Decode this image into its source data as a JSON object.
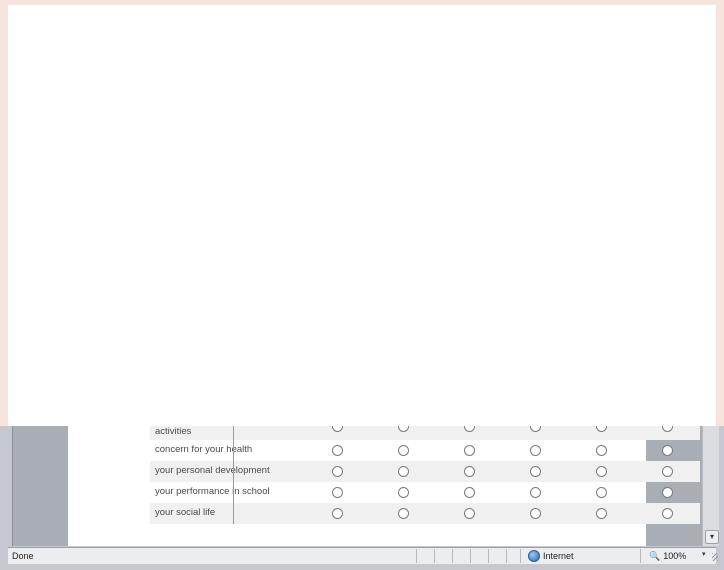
{
  "survey": {
    "rows": [
      {
        "label": "activities"
      },
      {
        "label": "concern for your health"
      },
      {
        "label": "your personal development"
      },
      {
        "label": "your performance in school"
      },
      {
        "label": "your social life"
      }
    ],
    "options_per_row": 6
  },
  "statusbar": {
    "status": "Done",
    "zone": "Internet",
    "zoom": "100%",
    "zoom_dropdown": "▾"
  },
  "scrollbar": {
    "down_arrow": "▾"
  }
}
